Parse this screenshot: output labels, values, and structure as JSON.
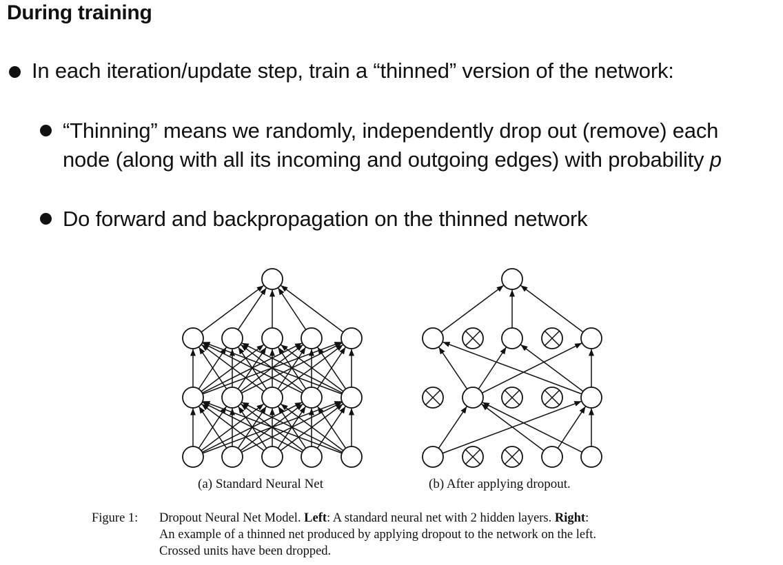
{
  "slide": {
    "heading": "During training",
    "bullets": [
      {
        "text": "In each iteration/update step, train a “thinned” version of the network:"
      },
      {
        "text_line1": "“Thinning” means we randomly, independently drop out (remove) each",
        "text_line2_main": "node (along with all its incoming and outgoing edges) with probability ",
        "text_line2_var": "p"
      },
      {
        "text": "Do forward and backpropagation on the thinned network"
      }
    ]
  },
  "figure": {
    "sublabel_a": "(a) Standard Neural Net",
    "sublabel_b": "(b) After applying dropout.",
    "caption": {
      "prefix": "Figure 1:",
      "line1_a": "Dropout Neural Net Model.",
      "line1_bold1": "Left",
      "line1_b": ": A standard neural net with 2 hidden layers.",
      "line1_bold2": "Right",
      "line1_c": ":",
      "line2": "An example of a thinned net produced by applying dropout to the network on the left.",
      "line3": "Crossed units have been dropped."
    },
    "network_a": {
      "layers": [
        5,
        5,
        5,
        1
      ],
      "dropped": []
    },
    "network_b": {
      "layers": [
        5,
        5,
        5,
        1
      ],
      "dropped": [
        [
          0,
          1
        ],
        [
          0,
          2
        ],
        [
          1,
          0
        ],
        [
          1,
          2
        ],
        [
          1,
          3
        ],
        [
          2,
          1
        ],
        [
          2,
          3
        ]
      ]
    },
    "colors": {
      "ink": "#111111",
      "node_fill": "#ffffff"
    }
  }
}
